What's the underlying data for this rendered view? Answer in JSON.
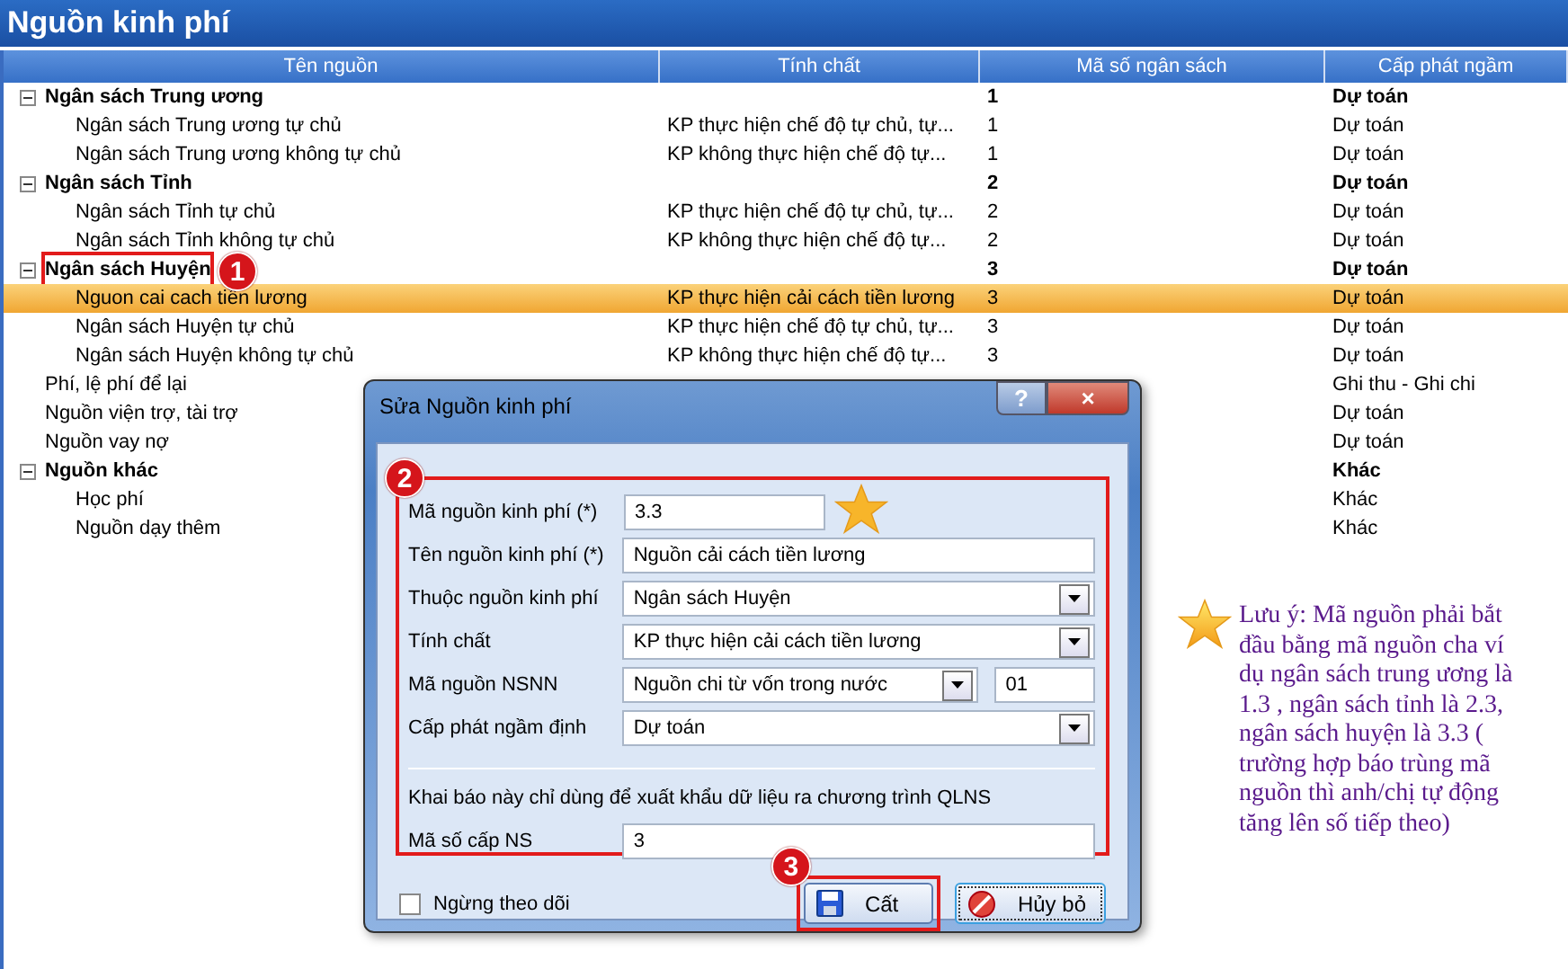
{
  "window": {
    "title": "Nguồn kinh phí"
  },
  "table": {
    "columns": [
      "Tên nguồn",
      "Tính chất",
      "Mã số ngân sách",
      "Cấp phát ngầm"
    ],
    "rows": [
      {
        "name": "Ngân sách Trung ương",
        "code": "1",
        "allocation": "Dự toán",
        "expanded": true,
        "selected": false,
        "children": [
          {
            "name": "Ngân sách Trung ương tự chủ",
            "property": "KP thực hiện chế độ tự chủ, tự...",
            "code": "1",
            "allocation": "Dự toán",
            "selected": false
          },
          {
            "name": "Ngân sách Trung ương không tự chủ",
            "property": "KP không thực hiện chế độ tự...",
            "code": "1",
            "allocation": "Dự toán",
            "selected": false
          }
        ]
      },
      {
        "name": "Ngân sách Tỉnh",
        "code": "2",
        "allocation": "Dự toán",
        "expanded": true,
        "selected": false,
        "children": [
          {
            "name": "Ngân sách Tỉnh tự chủ",
            "property": "KP thực hiện chế độ tự chủ, tự...",
            "code": "2",
            "allocation": "Dự toán",
            "selected": false
          },
          {
            "name": "Ngân sách Tỉnh không tự chủ",
            "property": "KP không thực hiện chế độ tự...",
            "code": "2",
            "allocation": "Dự toán",
            "selected": false
          }
        ]
      },
      {
        "name": "Ngân sách Huyện",
        "code": "3",
        "allocation": "Dự toán",
        "expanded": true,
        "selected": false,
        "marker": "1",
        "children": [
          {
            "name": "Nguon cai cach tiền lương",
            "property": "KP thực hiện cải cách tiền lương",
            "code": "3",
            "allocation": "Dự toán",
            "selected": true
          },
          {
            "name": "Ngân sách Huyện tự chủ",
            "property": "KP thực hiện chế độ tự chủ, tự...",
            "code": "3",
            "allocation": "Dự toán",
            "selected": false
          },
          {
            "name": "Ngân sách Huyện không tự chủ",
            "property": "KP không thực hiện chế độ tự...",
            "code": "3",
            "allocation": "Dự toán",
            "selected": false
          }
        ]
      },
      {
        "name": "Phí, lệ phí để lại",
        "allocation": "Ghi thu - Ghi chi",
        "selected": false
      },
      {
        "name": "Nguồn viện trợ, tài trợ",
        "allocation": "Dự toán",
        "selected": false
      },
      {
        "name": "Nguồn vay nợ",
        "allocation": "Dự toán",
        "selected": false
      },
      {
        "name": "Nguồn khác",
        "allocation": "Khác",
        "expanded": true,
        "selected": false,
        "children": [
          {
            "name": "Học phí",
            "allocation": "Khác",
            "selected": false
          },
          {
            "name": "Nguồn dạy thêm",
            "allocation": "Khác",
            "selected": false
          }
        ]
      }
    ]
  },
  "dialog": {
    "title": "Sửa Nguồn kinh phí",
    "help": "?",
    "close": "×",
    "marker": "2",
    "fields": [
      {
        "kind": "input",
        "label": "Mã nguồn kinh phí (*)",
        "value": "3.3",
        "short": true,
        "starred": true
      },
      {
        "kind": "input",
        "label": "Tên nguồn kinh phí (*)",
        "value": "Nguồn cải cách tiền lương"
      },
      {
        "kind": "select",
        "label": "Thuộc nguồn kinh phí",
        "value": "Ngân sách Huyện"
      },
      {
        "kind": "select",
        "label": "Tính chất",
        "value": "KP thực hiện cải cách tiền lương"
      },
      {
        "kind": "select_pair",
        "label": "Mã nguồn NSNN",
        "value": "Nguồn chi từ vốn trong nước",
        "extra": "01"
      },
      {
        "kind": "select",
        "label": "Cấp phát ngầm định",
        "value": "Dự toán"
      }
    ],
    "section_note": "Khai báo này chỉ dùng để xuất khẩu dữ liệu ra chương trình QLNS",
    "budget_field": {
      "label": "Mã số cấp NS",
      "value": "3"
    },
    "stop_tracking": {
      "label": "Ngừng theo dõi",
      "checked": false
    },
    "save": {
      "label": "Cất",
      "marker": "3"
    },
    "cancel": {
      "label": "Hủy bỏ"
    }
  },
  "note": {
    "text": "Lưu ý:  Mã nguồn phải bắt đầu bằng mã nguồn cha ví dụ ngân sách trung ương là 1.3 , ngân sách tỉnh là 2.3, ngân sách huyện là 3.3 ( trường hợp báo trùng mã nguồn thì anh/chị tự động tăng lên số tiếp theo)"
  }
}
